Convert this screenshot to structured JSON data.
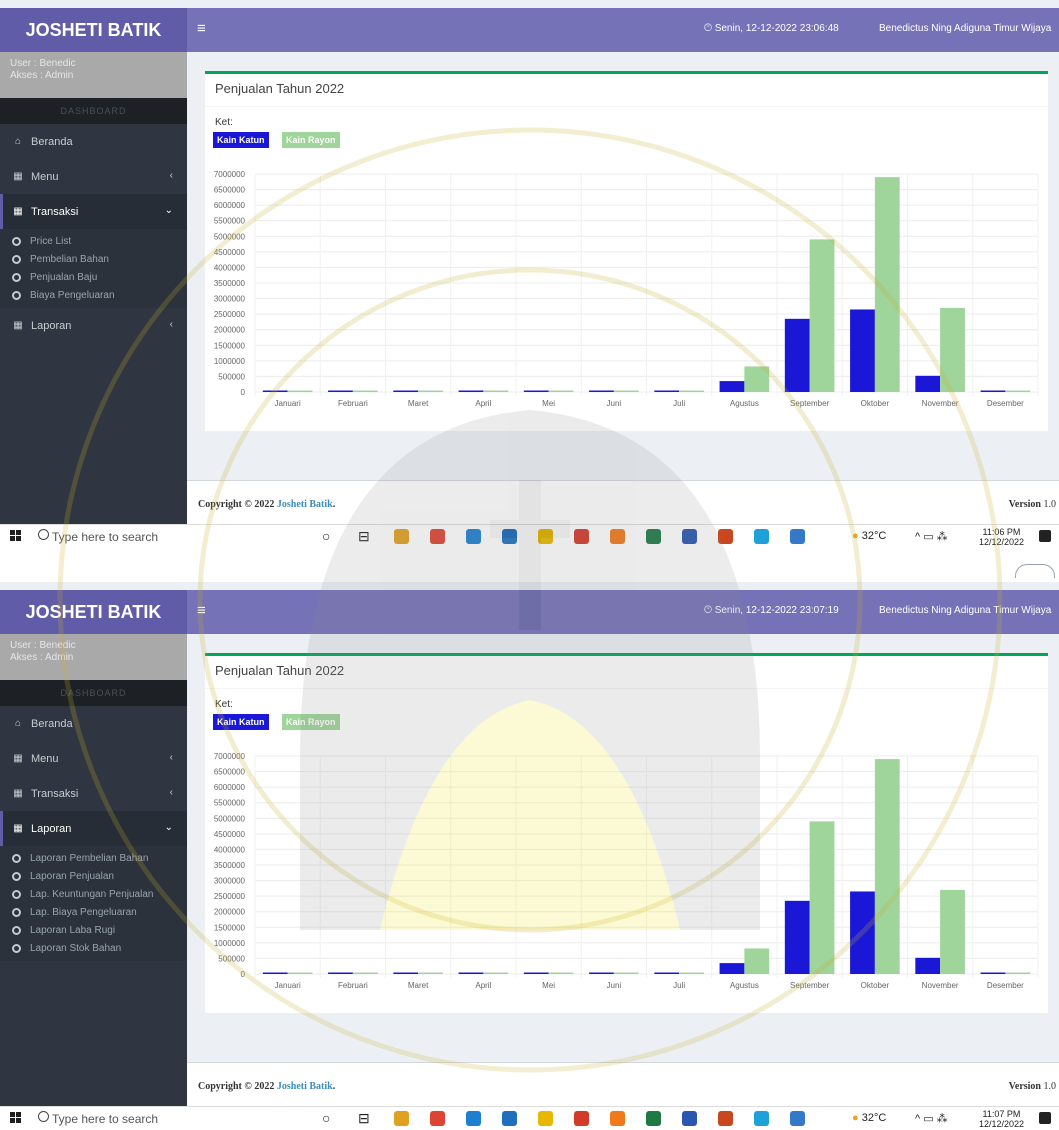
{
  "screens": [
    {
      "brand": "JOSHETI BATIK",
      "datetime": "Senin, 12-12-2022  23:06:48",
      "username": "Benedictus Ning Adiguna Timur Wijaya",
      "user_line": "User  : Benedic",
      "role_line": "Akses : Admin",
      "section_label": "DASHBOARD",
      "nav": [
        {
          "label": "Beranda",
          "icon": "home-icon",
          "arrow": ""
        },
        {
          "label": "Menu",
          "icon": "table-icon",
          "arrow": "‹"
        },
        {
          "label": "Transaksi",
          "icon": "table-icon",
          "arrow": "⌄",
          "active": true
        },
        {
          "label": "Laporan",
          "icon": "table-icon",
          "arrow": "‹"
        }
      ],
      "submenu_after": 2,
      "submenu": [
        "Price List",
        "Pembelian Bahan",
        "Penjualan Baju",
        "Biaya Pengeluaran"
      ],
      "clock_time": "11:06 PM",
      "clock_date": "12/12/2022"
    },
    {
      "brand": "JOSHETI BATIK",
      "datetime": "Senin, 12-12-2022  23:07:19",
      "username": "Benedictus Ning Adiguna Timur Wijaya",
      "user_line": "User  : Benedic",
      "role_line": "Akses : Admin",
      "section_label": "DASHBOARD",
      "nav": [
        {
          "label": "Beranda",
          "icon": "home-icon",
          "arrow": ""
        },
        {
          "label": "Menu",
          "icon": "table-icon",
          "arrow": "‹"
        },
        {
          "label": "Transaksi",
          "icon": "table-icon",
          "arrow": "‹"
        },
        {
          "label": "Laporan",
          "icon": "table-icon",
          "arrow": "⌄",
          "active": true
        }
      ],
      "submenu_after": 3,
      "submenu": [
        "Laporan Pembelian Bahan",
        "Laporan Penjualan",
        "Lap. Keuntungan Penjualan",
        "Lap. Biaya Pengeluaran",
        "Laporan Laba Rugi",
        "Laporan Stok Bahan"
      ],
      "clock_time": "11:07 PM",
      "clock_date": "12/12/2022"
    }
  ],
  "content": {
    "title": "Penjualan Tahun 2022",
    "ket_label": "Ket:",
    "legend": [
      "Kain Katun",
      "Kain Rayon"
    ]
  },
  "footer": {
    "copyright_prefix": "Copyright © 2022 ",
    "copyright_link": "Josheti Batik",
    "copyright_suffix": ".",
    "version_label": "Version",
    "version_value": "1.0"
  },
  "taskbar": {
    "search_placeholder": "Type here to search",
    "weather": "32°C",
    "icons": [
      "cortana-icon",
      "task-view-icon",
      "file-explorer-icon",
      "chrome-icon",
      "edge-icon",
      "mail-icon",
      "folder-icon",
      "wps-icon",
      "xampp-icon",
      "excel-icon",
      "word-icon",
      "powerpoint-icon",
      "app-icon",
      "photos-icon"
    ]
  },
  "colors": {
    "katun": "#1a18d6",
    "rayon": "#9fd49a",
    "header": "#605ca8",
    "accent": "#00a65a"
  },
  "chart_data": {
    "type": "bar",
    "categories": [
      "Januari",
      "Februari",
      "Maret",
      "April",
      "Mei",
      "Juni",
      "Juli",
      "Agustus",
      "September",
      "Oktober",
      "November",
      "Desember"
    ],
    "series": [
      {
        "name": "Kain Katun",
        "values": [
          0,
          0,
          0,
          0,
          0,
          0,
          0,
          350000,
          2350000,
          2650000,
          520000,
          0
        ]
      },
      {
        "name": "Kain Rayon",
        "values": [
          0,
          0,
          0,
          0,
          0,
          0,
          0,
          820000,
          4900000,
          6900000,
          2700000,
          0
        ]
      }
    ],
    "yticks": [
      7000000,
      6500000,
      6000000,
      5500000,
      5000000,
      4500000,
      4000000,
      3500000,
      3000000,
      2500000,
      2000000,
      1500000,
      1000000,
      500000,
      0
    ],
    "ylim": [
      0,
      7000000
    ],
    "grid": true,
    "legend_position": "top-left"
  }
}
